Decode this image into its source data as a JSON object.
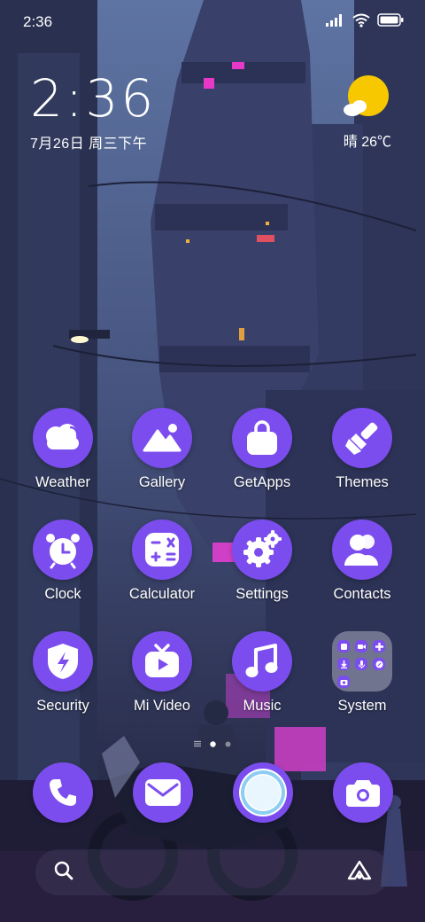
{
  "status_bar": {
    "time": "2:36",
    "icons": [
      "signal-icon",
      "wifi-icon",
      "battery-icon"
    ]
  },
  "clock_widget": {
    "time": "2:36",
    "date": "7月26日 周三下午"
  },
  "weather_widget": {
    "icon": "partly-sunny-icon",
    "text": "晴 26℃"
  },
  "apps": [
    {
      "label": "Weather",
      "icon": "weather-cloud-icon"
    },
    {
      "label": "Gallery",
      "icon": "gallery-mountain-icon"
    },
    {
      "label": "GetApps",
      "icon": "shopping-bag-icon"
    },
    {
      "label": "Themes",
      "icon": "paintbrush-icon"
    },
    {
      "label": "Clock",
      "icon": "alarm-clock-icon"
    },
    {
      "label": "Calculator",
      "icon": "calculator-icon"
    },
    {
      "label": "Settings",
      "icon": "gears-icon"
    },
    {
      "label": "Contacts",
      "icon": "contacts-people-icon"
    },
    {
      "label": "Security",
      "icon": "security-shield-icon"
    },
    {
      "label": "Mi Video",
      "icon": "tv-play-icon"
    },
    {
      "label": "Music",
      "icon": "music-note-icon"
    },
    {
      "label": "System",
      "icon": "folder-icon"
    }
  ],
  "dock": [
    {
      "icon": "phone-icon"
    },
    {
      "icon": "mail-icon"
    },
    {
      "icon": "browser-icon"
    },
    {
      "icon": "camera-icon"
    }
  ],
  "search_bar": {
    "left_icon": "search-icon",
    "right_icon": "assistant-icon"
  },
  "colors": {
    "icon_purple": "#7c4dee",
    "weather_sun": "#f7c800",
    "browser_ring": "#8ecdf2"
  }
}
